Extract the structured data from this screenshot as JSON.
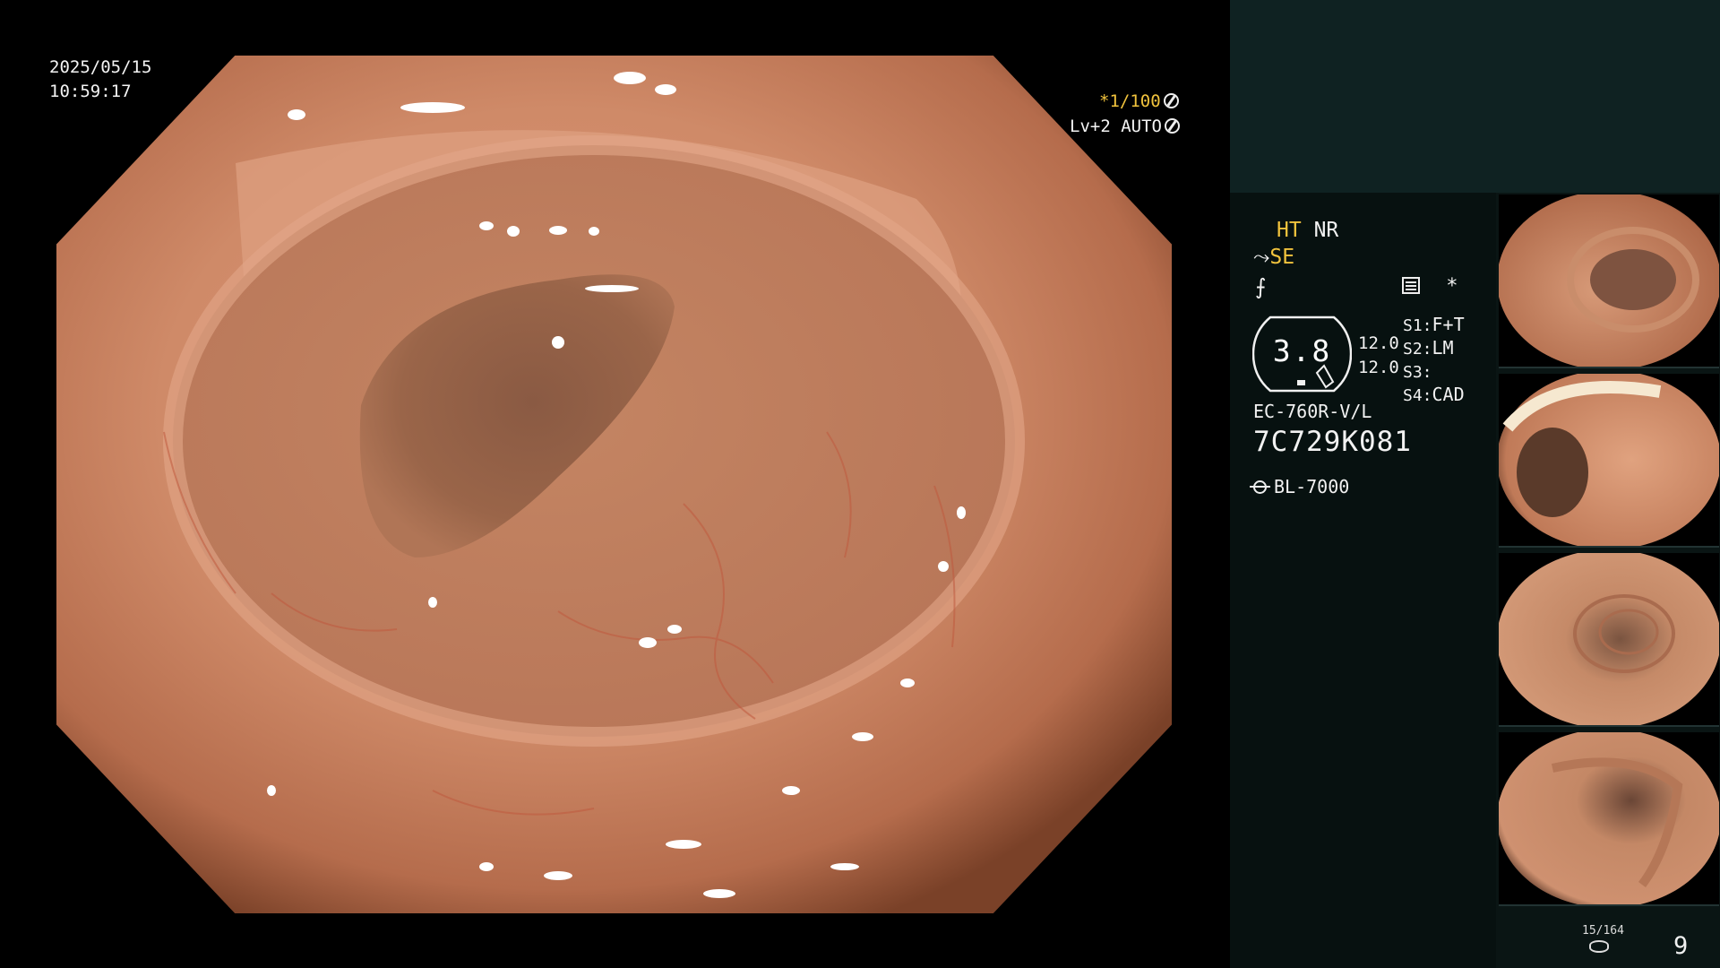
{
  "osd": {
    "date": "2025/05/15",
    "time": "10:59:17",
    "shutter_marker": "*",
    "shutter": "1/100",
    "agc": "Lv+2 AUTO"
  },
  "panel": {
    "mode_ht": "HT",
    "mode_nr": "NR",
    "se_prefix": "⤳",
    "se": "SE",
    "tilde_symbol": "⨍",
    "record_symbol": "*",
    "dial_value": "3.8",
    "gain_1": "12.0",
    "gain_2": "12.0",
    "s1_label": "S1:",
    "s1_value": "F+T",
    "s2_label": "S2:",
    "s2_value": "LM",
    "s3_label": "S3:",
    "s3_value": "",
    "s4_label": "S4:",
    "s4_value": "CAD",
    "scope_model": "EC-760R-V/L",
    "scope_serial": "7C729K081",
    "light_source": "BL-7000"
  },
  "thumbnails": [
    {
      "name": "thumb-1"
    },
    {
      "name": "thumb-2"
    },
    {
      "name": "thumb-3"
    },
    {
      "name": "thumb-4"
    }
  ],
  "footer": {
    "capture_count": "15/164",
    "page_number": "9"
  },
  "colors": {
    "panel_top": "#0f2222",
    "panel_lower": "#071110",
    "accent_yellow": "#f1c33d",
    "mucosa": "#c98363"
  }
}
